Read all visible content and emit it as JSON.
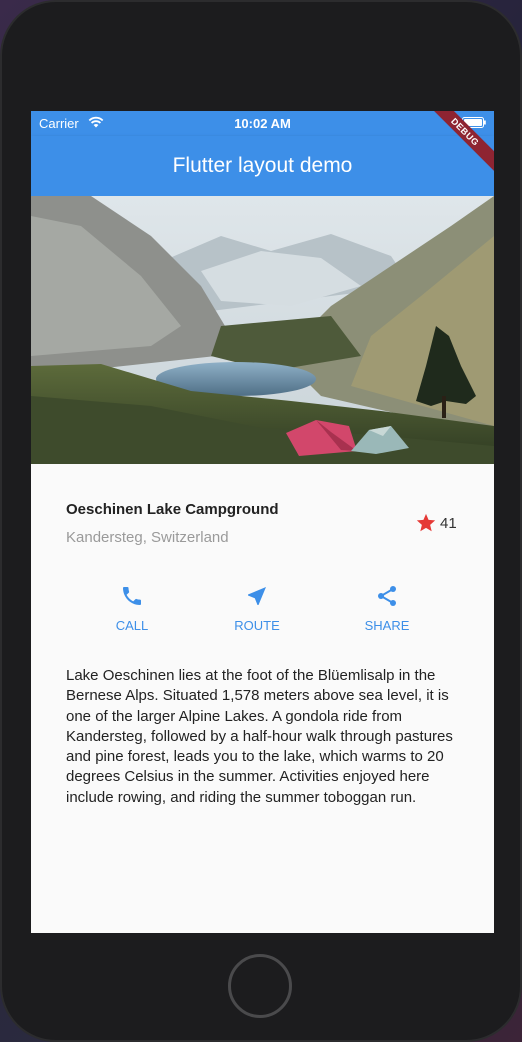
{
  "status_bar": {
    "carrier": "Carrier",
    "time": "10:02 AM"
  },
  "app_bar": {
    "title": "Flutter layout demo",
    "debug_banner": "DEBUG"
  },
  "place": {
    "title": "Oeschinen Lake Campground",
    "location": "Kandersteg, Switzerland",
    "star_count": "41"
  },
  "actions": [
    {
      "label": "CALL",
      "icon": "phone-icon"
    },
    {
      "label": "ROUTE",
      "icon": "near-me-icon"
    },
    {
      "label": "SHARE",
      "icon": "share-icon"
    }
  ],
  "description": "Lake Oeschinen lies at the foot of the Blüemlisalp in the Bernese Alps. Situated 1,578 meters above sea level, it is one of the larger Alpine Lakes. A gondola ride from Kandersteg, followed by a half-hour walk through pastures and pine forest, leads you to the lake, which warms to 20 degrees Celsius in the summer. Activities enjoyed here include rowing, and riding the summer toboggan run.",
  "colors": {
    "primary": "#3d8fe8",
    "star": "#e53935",
    "debug": "#8e2432"
  }
}
